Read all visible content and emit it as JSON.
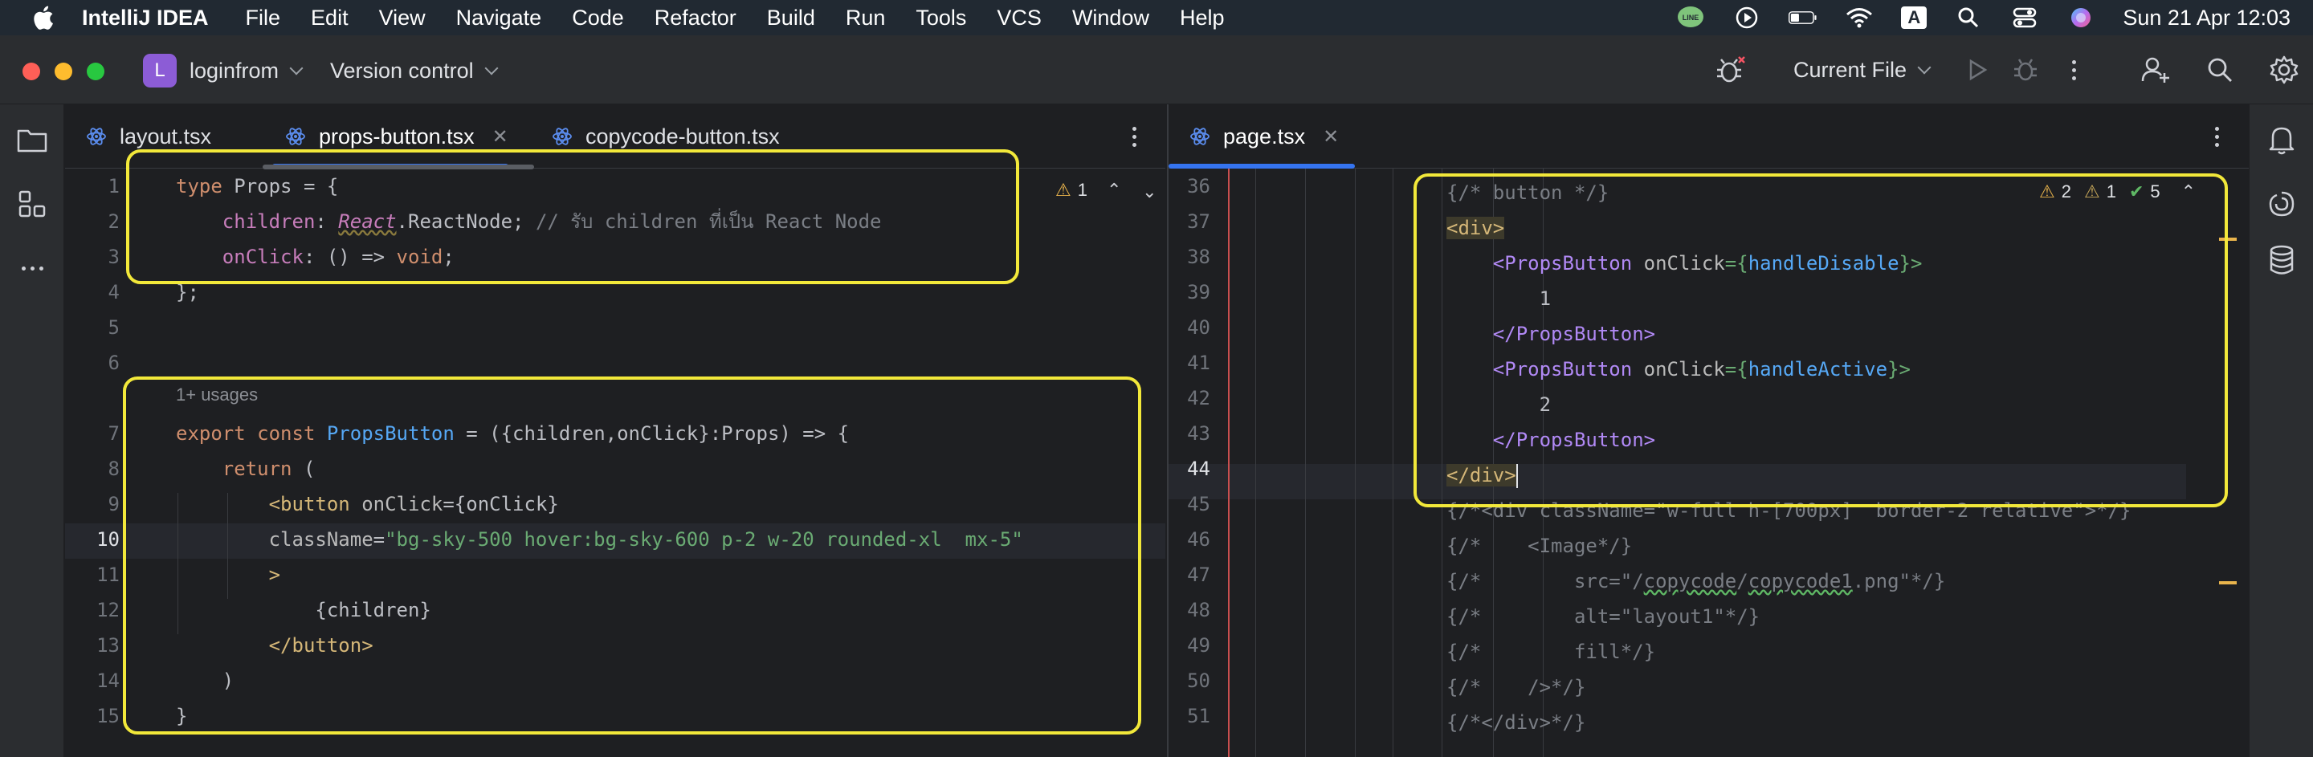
{
  "menubar": {
    "app_name": "IntelliJ IDEA",
    "items": [
      "File",
      "Edit",
      "View",
      "Navigate",
      "Code",
      "Refactor",
      "Build",
      "Run",
      "Tools",
      "VCS",
      "Window",
      "Help"
    ],
    "input_indicator": "A",
    "clock": "Sun 21 Apr  12:03",
    "icons": [
      "apple-logo",
      "line-icon",
      "play-circle-icon",
      "battery-icon",
      "wifi-icon",
      "input-source-icon",
      "spotlight-search-icon",
      "control-center-icon",
      "siri-icon"
    ]
  },
  "titlebar": {
    "project_badge": "L",
    "project_name": "loginfrom",
    "vcs_label": "Version control",
    "run_config": "Current File"
  },
  "left_editor": {
    "tabs": [
      {
        "label": "layout.tsx",
        "active": false
      },
      {
        "label": "props-button.tsx",
        "active": true
      },
      {
        "label": "copycode-button.tsx",
        "active": false
      }
    ],
    "inspection_warnings": "1",
    "lines": [
      {
        "n": "1"
      },
      {
        "n": "2"
      },
      {
        "n": "3"
      },
      {
        "n": "4"
      },
      {
        "n": "5"
      },
      {
        "n": "6"
      },
      {
        "n": "7"
      },
      {
        "n": "8"
      },
      {
        "n": "9"
      },
      {
        "n": "10"
      },
      {
        "n": "11"
      },
      {
        "n": "12"
      },
      {
        "n": "13"
      },
      {
        "n": "14"
      },
      {
        "n": "15"
      }
    ],
    "usages_hint": "1+ usages",
    "code": {
      "l1_kw": "type",
      "l1_rest": " Props = {",
      "l2_prop": "children",
      "l2_colon": ": ",
      "l2_react": "React",
      "l2_type": ".ReactNode; ",
      "l2_comment": "// รับ children ที่เป็น React Node",
      "l3_prop": "onClick",
      "l3_rest": ": () => ",
      "l3_kw": "void",
      "l3_end": ";",
      "l4": "};",
      "l7_kw1": "export",
      "l7_kw2": "const",
      "l7_name": "PropsButton",
      "l7_rest": " = ({children,onClick}:Props) => {",
      "l8_kw": "return",
      "l8_rest": " (",
      "l9_tag": "<button",
      "l9_attr": " onClick",
      "l9_rest": "={onClick}",
      "l10_attr": "className",
      "l10_eq": "=",
      "l10_str": "\"bg-sky-500 hover:bg-sky-600 p-2 w-20 rounded-xl  mx-5\"",
      "l11": ">",
      "l12": "{children}",
      "l13": "</button>",
      "l14": ")",
      "l15": "}"
    }
  },
  "right_editor": {
    "tabs": [
      {
        "label": "page.tsx",
        "active": true
      }
    ],
    "inspection": {
      "warnings": "2",
      "weak_warnings": "1",
      "ok": "5"
    },
    "lines": [
      {
        "n": "36"
      },
      {
        "n": "37"
      },
      {
        "n": "38"
      },
      {
        "n": "39"
      },
      {
        "n": "40"
      },
      {
        "n": "41"
      },
      {
        "n": "42"
      },
      {
        "n": "43"
      },
      {
        "n": "44"
      },
      {
        "n": "45"
      },
      {
        "n": "46"
      },
      {
        "n": "47"
      },
      {
        "n": "48"
      },
      {
        "n": "49"
      },
      {
        "n": "50"
      },
      {
        "n": "51"
      }
    ],
    "code": {
      "l36": "{/* button */}",
      "l37": "<div>",
      "l38_tag": "<PropsButton",
      "l38_attr": " onClick",
      "l38_eq": "={",
      "l38_fn": "handleDisable",
      "l38_end": "}>",
      "l39": "1",
      "l40": "</PropsButton>",
      "l41_tag": "<PropsButton",
      "l41_attr": " onClick",
      "l41_eq": "={",
      "l41_fn": "handleActive",
      "l41_end": "}>",
      "l42": "2",
      "l43": "</PropsButton>",
      "l44": "</div>",
      "l45": "{/*<div className=\"w-full h-[700px]  border-2 relative\">*/}",
      "l46": "{/*    <Image*/}",
      "l47a": "{/*        src=\"/",
      "l47b": "copycode",
      "l47c": "/",
      "l47d": "copycode1",
      "l47e": ".png\"*/}",
      "l48": "{/*        alt=\"layout1\"*/}",
      "l49": "{/*        fill*/}",
      "l50": "{/*    />*/}",
      "l51": "{/*</div>*/}"
    }
  },
  "colors": {
    "highlight_box": "#f2e83a",
    "accent": "#3574f0",
    "background": "#1e1f22"
  }
}
